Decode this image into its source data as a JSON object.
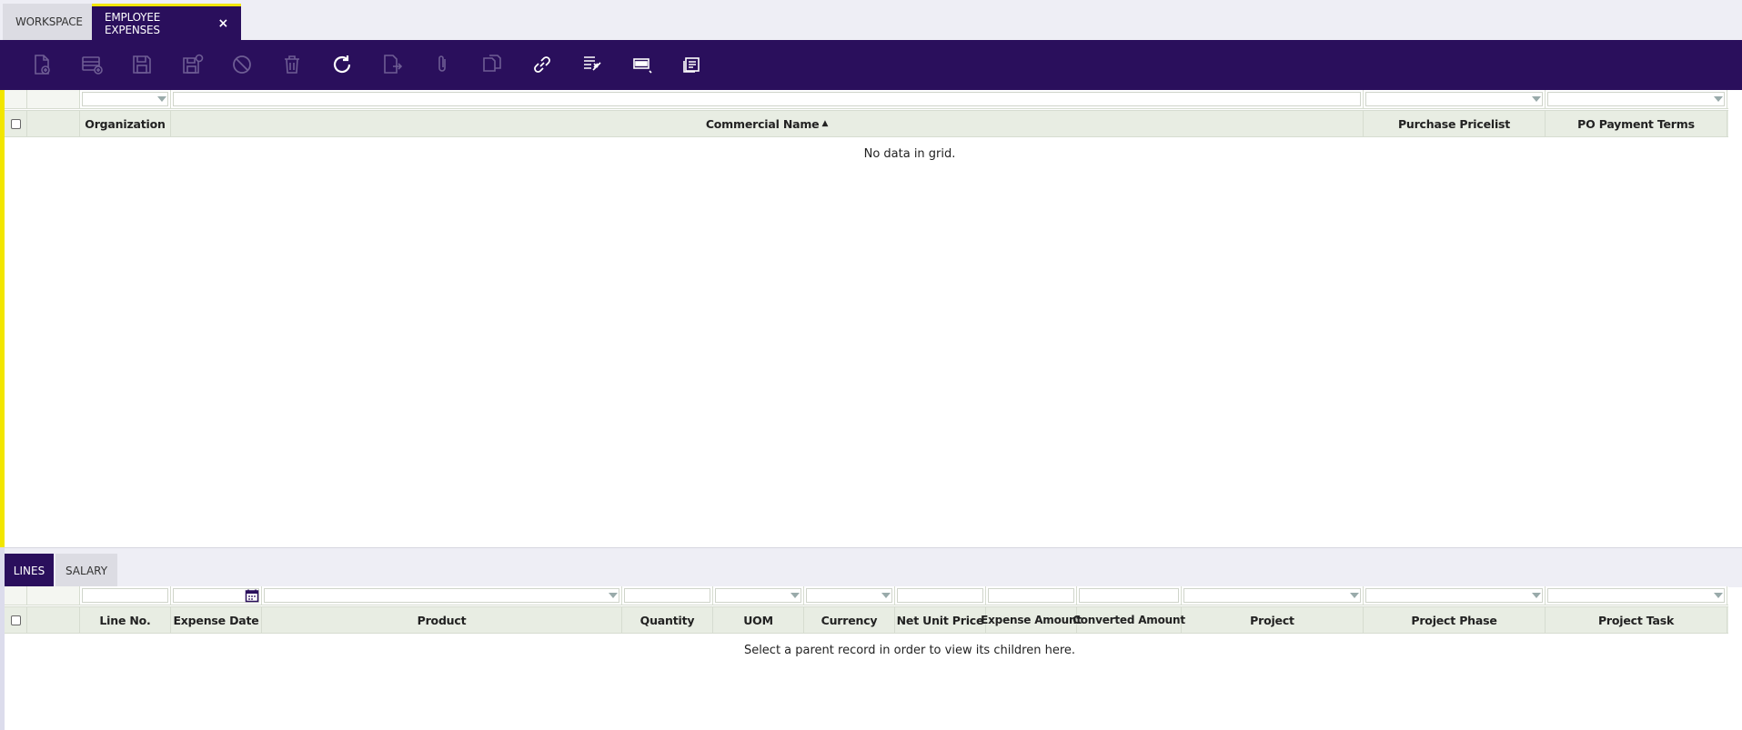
{
  "tabs": {
    "workspace": "WORKSPACE",
    "active": "EMPLOYEE EXPENSES",
    "close": "×"
  },
  "toolbar": {
    "buttons": [
      {
        "name": "new-document-icon",
        "enabled": false
      },
      {
        "name": "new-row-icon",
        "enabled": false
      },
      {
        "name": "save-icon",
        "enabled": false
      },
      {
        "name": "save-close-icon",
        "enabled": false
      },
      {
        "name": "undo-icon",
        "enabled": false
      },
      {
        "name": "delete-icon",
        "enabled": false
      },
      {
        "name": "refresh-icon",
        "enabled": true
      },
      {
        "name": "export-icon",
        "enabled": false
      },
      {
        "name": "attachment-icon",
        "enabled": false
      },
      {
        "name": "copy-record-icon",
        "enabled": false
      },
      {
        "name": "link-icon",
        "enabled": true
      },
      {
        "name": "filter-grid-icon",
        "enabled": true
      },
      {
        "name": "view-toggle-icon",
        "enabled": true
      },
      {
        "name": "notes-icon",
        "enabled": true
      }
    ]
  },
  "upper_grid": {
    "columns": [
      "Organization",
      "Commercial Name",
      "Purchase Pricelist",
      "PO Payment Terms"
    ],
    "sort_indicator": "▲",
    "empty_message": "No data in grid."
  },
  "sub_tabs": {
    "lines": "LINES",
    "salary": "SALARY"
  },
  "lower_grid": {
    "columns": [
      "Line No.",
      "Expense Date",
      "Product",
      "Quantity",
      "UOM",
      "Currency",
      "Net Unit Price",
      "Expense Amount",
      "Converted Amount",
      "Project",
      "Project Phase",
      "Project Task"
    ],
    "empty_message": "Select a parent record in order to view its children here."
  },
  "colors": {
    "brand": "#2a0f5c",
    "accent": "#f2e600",
    "header_bg": "#e8ede3"
  }
}
